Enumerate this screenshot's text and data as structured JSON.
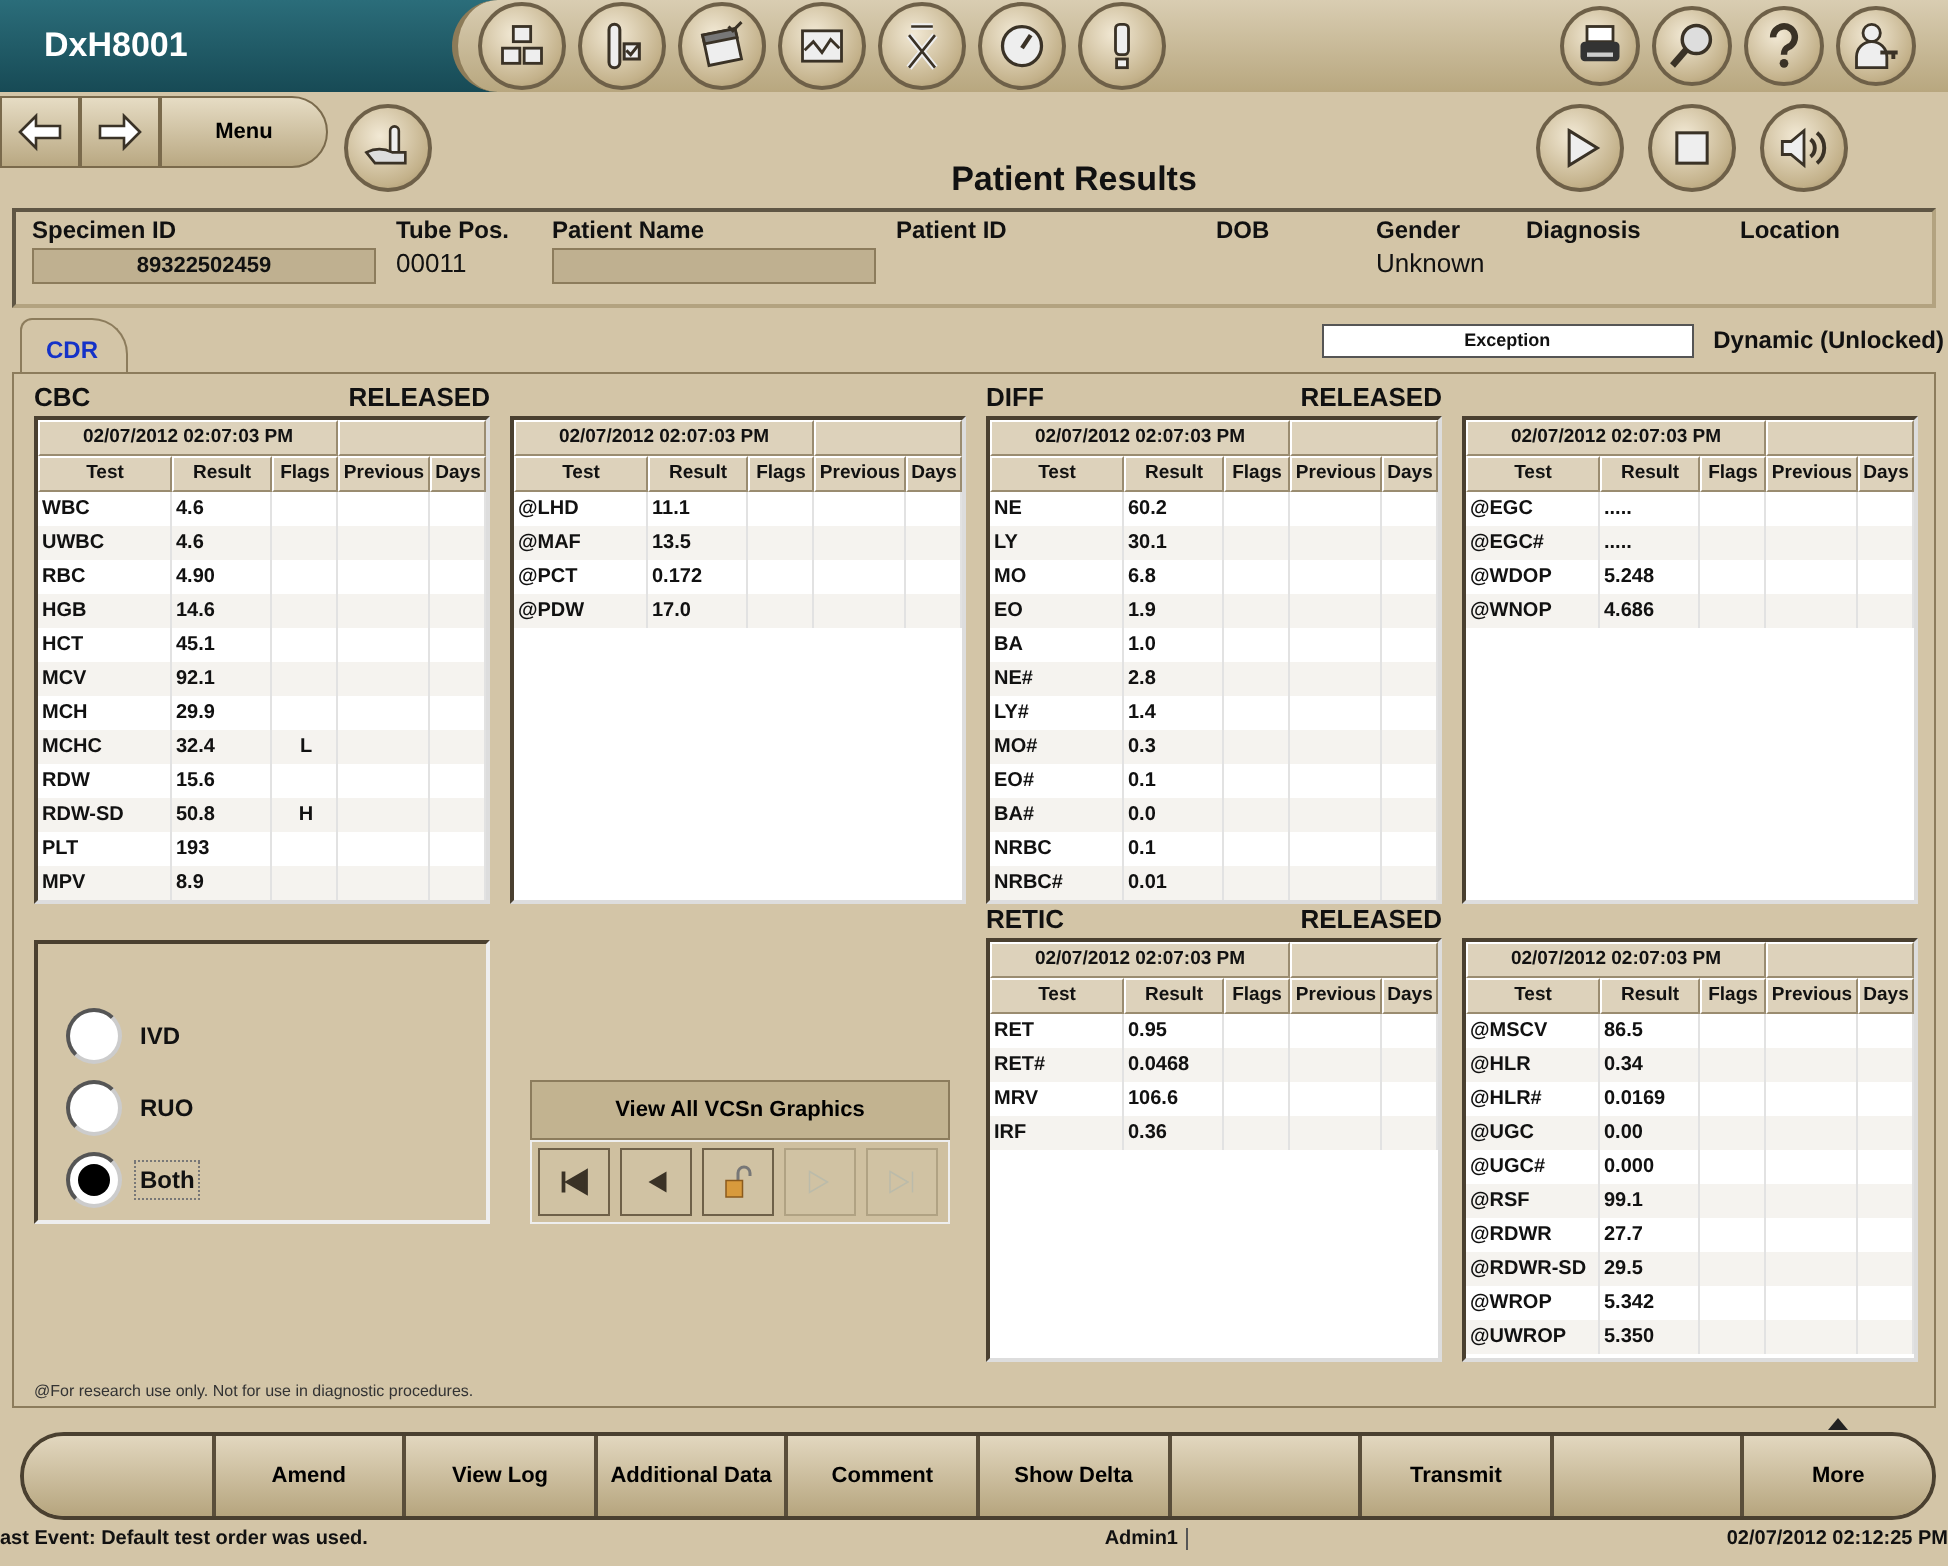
{
  "app": {
    "name": "DxH8001"
  },
  "toolbar": [
    {
      "kind": "cubes"
    },
    {
      "kind": "tube"
    },
    {
      "kind": "calendar"
    },
    {
      "kind": "chart"
    },
    {
      "kind": "xbar"
    },
    {
      "kind": "gauge"
    },
    {
      "kind": "alert"
    }
  ],
  "utilities": [
    {
      "kind": "printer"
    },
    {
      "kind": "search"
    },
    {
      "kind": "help"
    },
    {
      "kind": "user"
    }
  ],
  "nav": [
    {
      "kind": "back"
    },
    {
      "kind": "forward"
    },
    {
      "kind": "menu",
      "label": "Menu"
    }
  ],
  "hand_button": {
    "kind": "hand"
  },
  "screen_title": "Patient Results",
  "transport": [
    {
      "kind": "play"
    },
    {
      "kind": "stop"
    },
    {
      "kind": "sound"
    }
  ],
  "patient_header": [
    {
      "label": "Specimen ID",
      "kind": "box",
      "value": "89322502459"
    },
    {
      "label": "Tube Pos.",
      "kind": "plain",
      "value": "00011"
    },
    {
      "label": "Patient Name",
      "kind": "box"
    },
    {
      "label": "Patient ID",
      "kind": "plain"
    },
    {
      "label": "DOB",
      "kind": "plain"
    },
    {
      "label": "Gender",
      "kind": "plain",
      "value": "Unknown"
    },
    {
      "label": "Diagnosis",
      "kind": "plain"
    },
    {
      "label": "Location",
      "kind": "plain"
    }
  ],
  "tabs": [
    {
      "label": "CDR",
      "selected": true
    }
  ],
  "exception_field": {
    "value": "Exception"
  },
  "mode": "Dynamic (Unlocked)",
  "columns": [
    {
      "sections": [
        {
          "title": "CBC",
          "status": "RELEASED",
          "tables": [
            {
              "timestamp": "02/07/2012 02:07:03 PM",
              "columns": [
                "Test",
                "Result",
                "Flags",
                "Previous",
                "Days"
              ],
              "rows": [
                {
                  "test": "WBC",
                  "result": "4.6"
                },
                {
                  "test": "UWBC",
                  "result": "4.6"
                },
                {
                  "test": "RBC",
                  "result": "4.90"
                },
                {
                  "test": "HGB",
                  "result": "14.6"
                },
                {
                  "test": "HCT",
                  "result": "45.1"
                },
                {
                  "test": "MCV",
                  "result": "92.1"
                },
                {
                  "test": "MCH",
                  "result": "29.9"
                },
                {
                  "test": "MCHC",
                  "result": "32.4",
                  "flag": "L"
                },
                {
                  "test": "RDW",
                  "result": "15.6"
                },
                {
                  "test": "RDW-SD",
                  "result": "50.8",
                  "flag": "H"
                },
                {
                  "test": "PLT",
                  "result": "193"
                },
                {
                  "test": "MPV",
                  "result": "8.9"
                }
              ]
            },
            {
              "timestamp": "02/07/2012 02:07:03 PM",
              "columns": [
                "Test",
                "Result",
                "Flags",
                "Previous",
                "Days"
              ],
              "rows": [
                {
                  "test": "@LHD",
                  "result": "11.1"
                },
                {
                  "test": "@MAF",
                  "result": "13.5"
                },
                {
                  "test": "@PCT",
                  "result": "0.172"
                },
                {
                  "test": "@PDW",
                  "result": "17.0"
                }
              ]
            }
          ]
        }
      ]
    },
    {
      "sections": [
        {
          "title": "DIFF",
          "status": "RELEASED",
          "tables": [
            {
              "timestamp": "02/07/2012 02:07:03 PM",
              "columns": [
                "Test",
                "Result",
                "Flags",
                "Previous",
                "Days"
              ],
              "rows": [
                {
                  "test": "NE",
                  "result": "60.2"
                },
                {
                  "test": "LY",
                  "result": "30.1"
                },
                {
                  "test": "MO",
                  "result": "6.8"
                },
                {
                  "test": "EO",
                  "result": "1.9"
                },
                {
                  "test": "BA",
                  "result": "1.0"
                },
                {
                  "test": "NE#",
                  "result": "2.8"
                },
                {
                  "test": "LY#",
                  "result": "1.4"
                },
                {
                  "test": "MO#",
                  "result": "0.3"
                },
                {
                  "test": "EO#",
                  "result": "0.1"
                },
                {
                  "test": "BA#",
                  "result": "0.0"
                },
                {
                  "test": "NRBC",
                  "result": "0.1"
                },
                {
                  "test": "NRBC#",
                  "result": "0.01"
                }
              ]
            },
            {
              "timestamp": "02/07/2012 02:07:03 PM",
              "columns": [
                "Test",
                "Result",
                "Flags",
                "Previous",
                "Days"
              ],
              "rows": [
                {
                  "test": "@EGC",
                  "result": "....."
                },
                {
                  "test": "@EGC#",
                  "result": "....."
                },
                {
                  "test": "@WDOP",
                  "result": "5.248"
                },
                {
                  "test": "@WNOP",
                  "result": "4.686"
                }
              ]
            }
          ]
        },
        {
          "title": "RETIC",
          "status": "RELEASED",
          "tables": [
            {
              "timestamp": "02/07/2012 02:07:03 PM",
              "columns": [
                "Test",
                "Result",
                "Flags",
                "Previous",
                "Days"
              ],
              "rows": [
                {
                  "test": "RET",
                  "result": "0.95"
                },
                {
                  "test": "RET#",
                  "result": "0.0468"
                },
                {
                  "test": "MRV",
                  "result": "106.6"
                },
                {
                  "test": "IRF",
                  "result": "0.36"
                }
              ]
            },
            {
              "timestamp": "02/07/2012 02:07:03 PM",
              "columns": [
                "Test",
                "Result",
                "Flags",
                "Previous",
                "Days"
              ],
              "rows": [
                {
                  "test": "@MSCV",
                  "result": "86.5"
                },
                {
                  "test": "@HLR",
                  "result": "0.34"
                },
                {
                  "test": "@HLR#",
                  "result": "0.0169"
                },
                {
                  "test": "@UGC",
                  "result": "0.00"
                },
                {
                  "test": "@UGC#",
                  "result": "0.000"
                },
                {
                  "test": "@RSF",
                  "result": "99.1"
                },
                {
                  "test": "@RDWR",
                  "result": "27.7"
                },
                {
                  "test": "@RDWR-SD",
                  "result": "29.5"
                },
                {
                  "test": "@WROP",
                  "result": "5.342"
                },
                {
                  "test": "@UWROP",
                  "result": "5.350"
                }
              ]
            }
          ]
        }
      ]
    }
  ],
  "radio_options": [
    {
      "label": "IVD",
      "selected": false
    },
    {
      "label": "RUO",
      "selected": false
    },
    {
      "label": "Both",
      "selected": true
    }
  ],
  "graphics_button": {
    "label": "View All VCSn Graphics"
  },
  "pager": [
    {
      "kind": "first",
      "disabled": false
    },
    {
      "kind": "prev",
      "disabled": false
    },
    {
      "kind": "lock",
      "disabled": false
    },
    {
      "kind": "next",
      "disabled": true
    },
    {
      "kind": "last",
      "disabled": true
    }
  ],
  "footnote": "@For research use only. Not for use in diagnostic procedures.",
  "actions": [
    {
      "kind": "blank"
    },
    {
      "kind": "label",
      "label": "Amend"
    },
    {
      "kind": "label",
      "label": "View Log"
    },
    {
      "kind": "label",
      "label": "Additional Data"
    },
    {
      "kind": "label",
      "label": "Comment"
    },
    {
      "kind": "label",
      "label": "Show Delta"
    },
    {
      "kind": "blank"
    },
    {
      "kind": "label",
      "label": "Transmit"
    },
    {
      "kind": "blank"
    },
    {
      "kind": "menu",
      "label": "More"
    }
  ],
  "status_bar": {
    "event": "ast Event: Default test order was used.",
    "user": "Admin1",
    "datetime": "02/07/2012 02:12:25 PM"
  }
}
